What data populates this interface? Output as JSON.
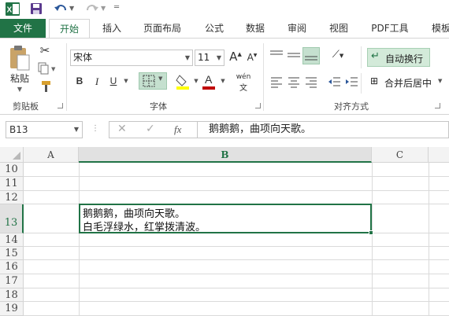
{
  "colors": {
    "accent": "#217346",
    "tab_file_bg": "#217346",
    "highlight": "#ffff00",
    "font_red": "#c00000",
    "wrap_btn_bg": "#d3ead9"
  },
  "quick_access": {
    "icons": [
      "excel-logo-icon",
      "save-icon",
      "undo-icon",
      "redo-icon",
      "customize-icon"
    ]
  },
  "tabs": [
    "文件",
    "开始",
    "插入",
    "页面布局",
    "公式",
    "数据",
    "审阅",
    "视图",
    "PDF工具",
    "模板"
  ],
  "ribbon": {
    "clipboard": {
      "paste_label": "粘贴",
      "group_label": "剪贴板"
    },
    "font": {
      "font_name": "宋体",
      "font_size": "11",
      "group_label": "字体",
      "bold": "B",
      "italic": "I",
      "underline": "U",
      "grow": "A",
      "shrink": "A",
      "phonetic": "wén"
    },
    "alignment": {
      "wrap_label": "自动换行",
      "merge_label": "合并后居中",
      "group_label": "对齐方式"
    }
  },
  "formula_bar": {
    "name_box": "B13",
    "fx": "fx",
    "content": "鹅鹅鹅，曲项向天歌。"
  },
  "sheet": {
    "columns": [
      "A",
      "B",
      "C"
    ],
    "rows": [
      "10",
      "11",
      "12",
      "13",
      "14",
      "15",
      "16",
      "17",
      "18",
      "19"
    ],
    "active_cell": {
      "line1": "鹅鹅鹅，曲项向天歌。",
      "line2": "白毛浮绿水，红掌拨清波。"
    }
  }
}
